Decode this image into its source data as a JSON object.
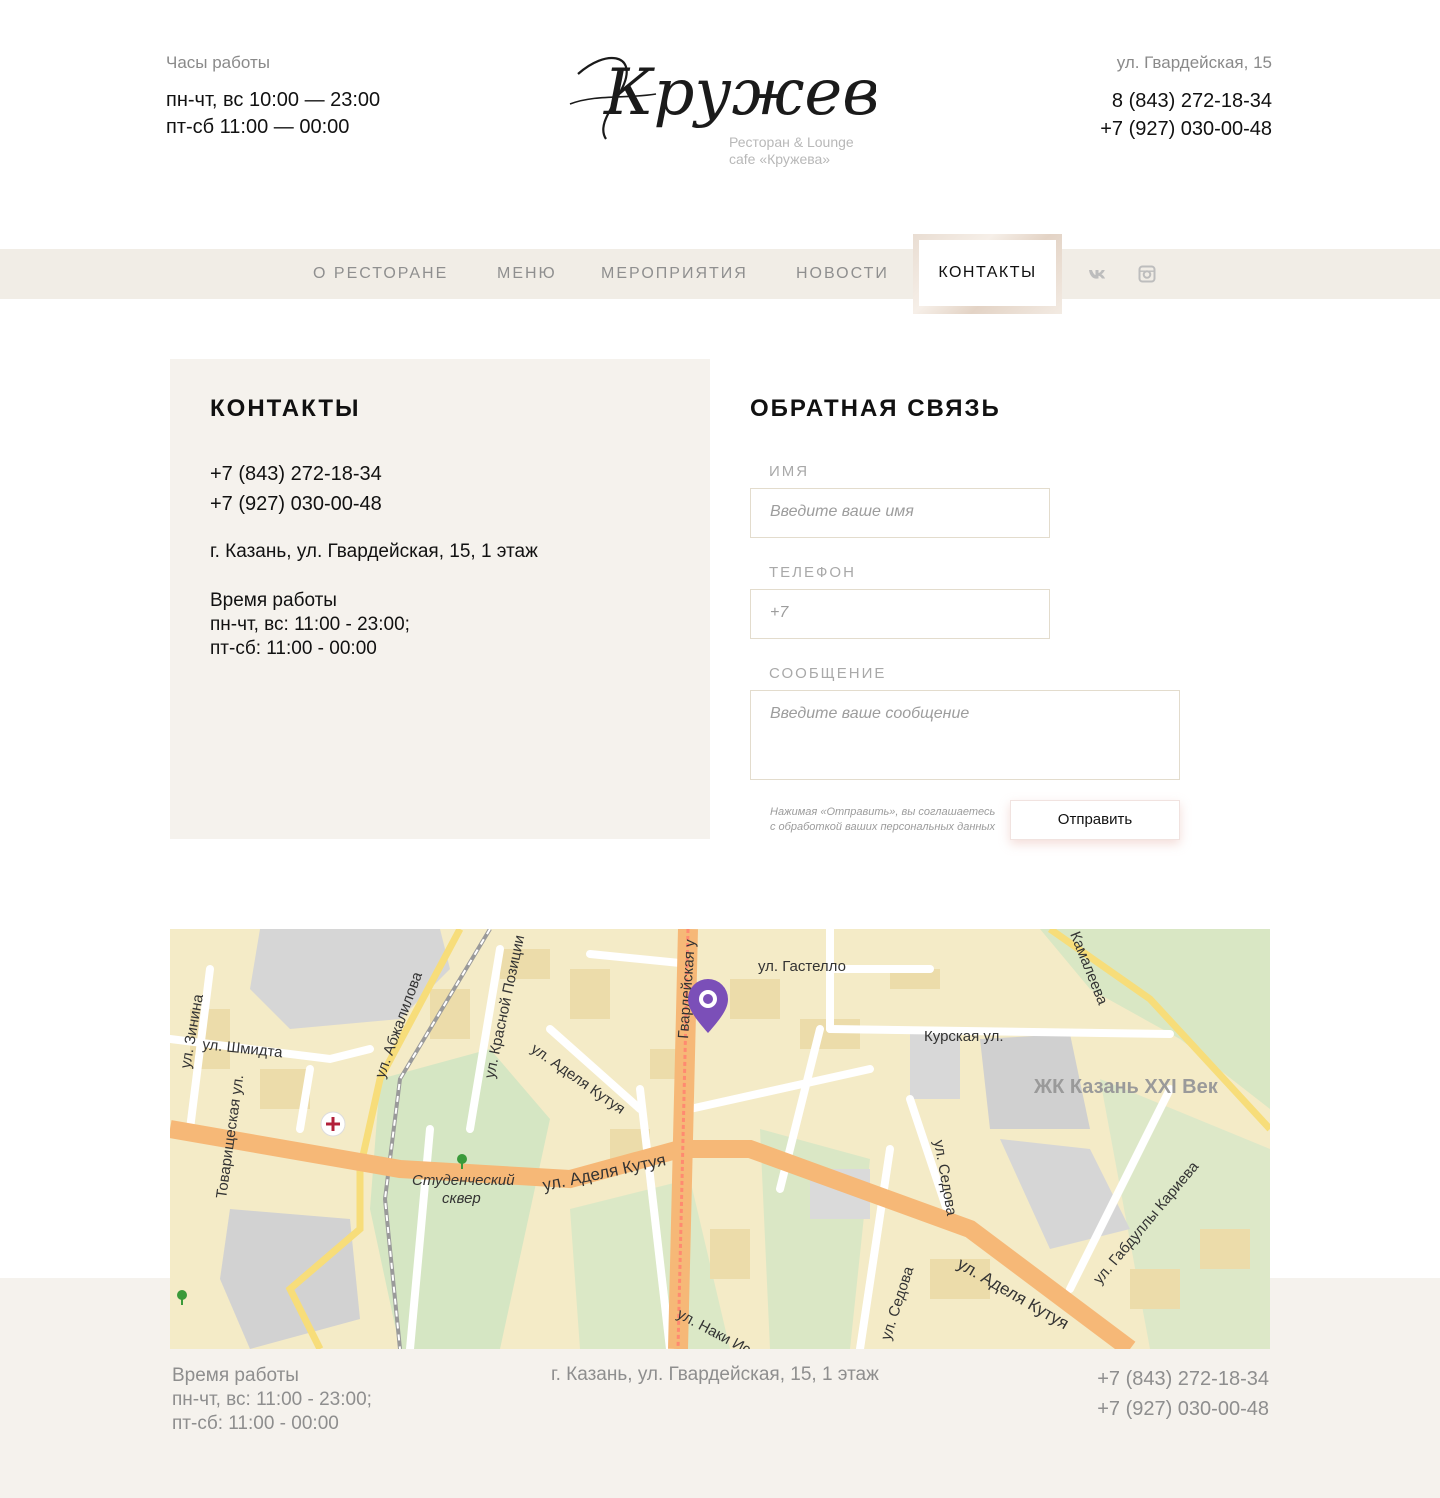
{
  "header": {
    "hours_caption": "Часы работы",
    "hours_line1": "пн-чт, вс 10:00 — 23:00",
    "hours_line2": "пт-сб 11:00 — 00:00",
    "logo_text": "Кружева",
    "logo_sub1": "Ресторан & Lounge",
    "logo_sub2": "cafe «Кружева»",
    "address": "ул. Гвардейская, 15",
    "phone1": "8 (843) 272-18-34",
    "phone2": "+7 (927) 030-00-48"
  },
  "nav": {
    "items": [
      {
        "label": "О РЕСТОРАНЕ"
      },
      {
        "label": "МЕНЮ"
      },
      {
        "label": "МЕРОПРИЯТИЯ"
      },
      {
        "label": "НОВОСТИ"
      },
      {
        "label": "КОНТАКТЫ",
        "active": true
      }
    ],
    "social": [
      "vk-icon",
      "instagram-icon"
    ]
  },
  "contacts": {
    "title": "КОНТАКТЫ",
    "phone1": "+7 (843) 272-18-34",
    "phone2": "+7 (927) 030-00-48",
    "address": "г. Казань, ул. Гвардейская, 15, 1 этаж",
    "hours_title": "Время работы",
    "hours_line1": "пн-чт, вс: 11:00 - 23:00;",
    "hours_line2": "пт-сб: 11:00 - 00:00"
  },
  "feedback": {
    "title": "ОБРАТНАЯ СВЯЗЬ",
    "name_label": "ИМЯ",
    "name_placeholder": "Введите ваше имя",
    "phone_label": "ТЕЛЕФОН",
    "phone_placeholder": "+7",
    "message_label": "СООБЩЕНИЕ",
    "message_placeholder": "Введите ваше сообщение",
    "consent_line1": "Нажимая «Отправить», вы соглашаетесь",
    "consent_line2": "с обработкой ваших персональных данных",
    "submit": "Отправить"
  },
  "map": {
    "labels": {
      "gastello": "ул. Гастелло",
      "kamaleeva": "Камалеева",
      "kurskaya": "Курская ул.",
      "zk": "ЖК Казань XXI Век",
      "zinina": "ул. Зинина",
      "shmidta": "ул. Шмидта",
      "abzhalilova": "ул. Абжалилова",
      "krasnoy": "ул. Красной Позиции",
      "kutuya1": "ул. Аделя Кутуя",
      "kutuya2": "ул. Аделя Кутуя",
      "kutuya3": "ул. Аделя Кутуя",
      "gvardeyskaya": "Гвардейская у",
      "tovarishcheskaya": "Товарищеская ул.",
      "studench1": "Студенческий",
      "studench2": "сквер",
      "sedova1": "ул. Седова",
      "sedova2": "ул. Седова",
      "karieva": "ул. Габдуллы Кариева",
      "naki": "ул. Наки Иса"
    },
    "colors": {
      "pin": "#7b4fb8",
      "main_road": "#f6b877",
      "highlight": "#ff9a7a"
    }
  },
  "footer": {
    "hours_title": "Время работы",
    "hours_line1": "пн-чт, вс: 11:00 - 23:00;",
    "hours_line2": "пт-сб: 11:00 - 00:00",
    "address": "г. Казань, ул. Гвардейская, 15, 1 этаж",
    "phone1": "+7 (843) 272-18-34",
    "phone2": "+7 (927) 030-00-48"
  }
}
